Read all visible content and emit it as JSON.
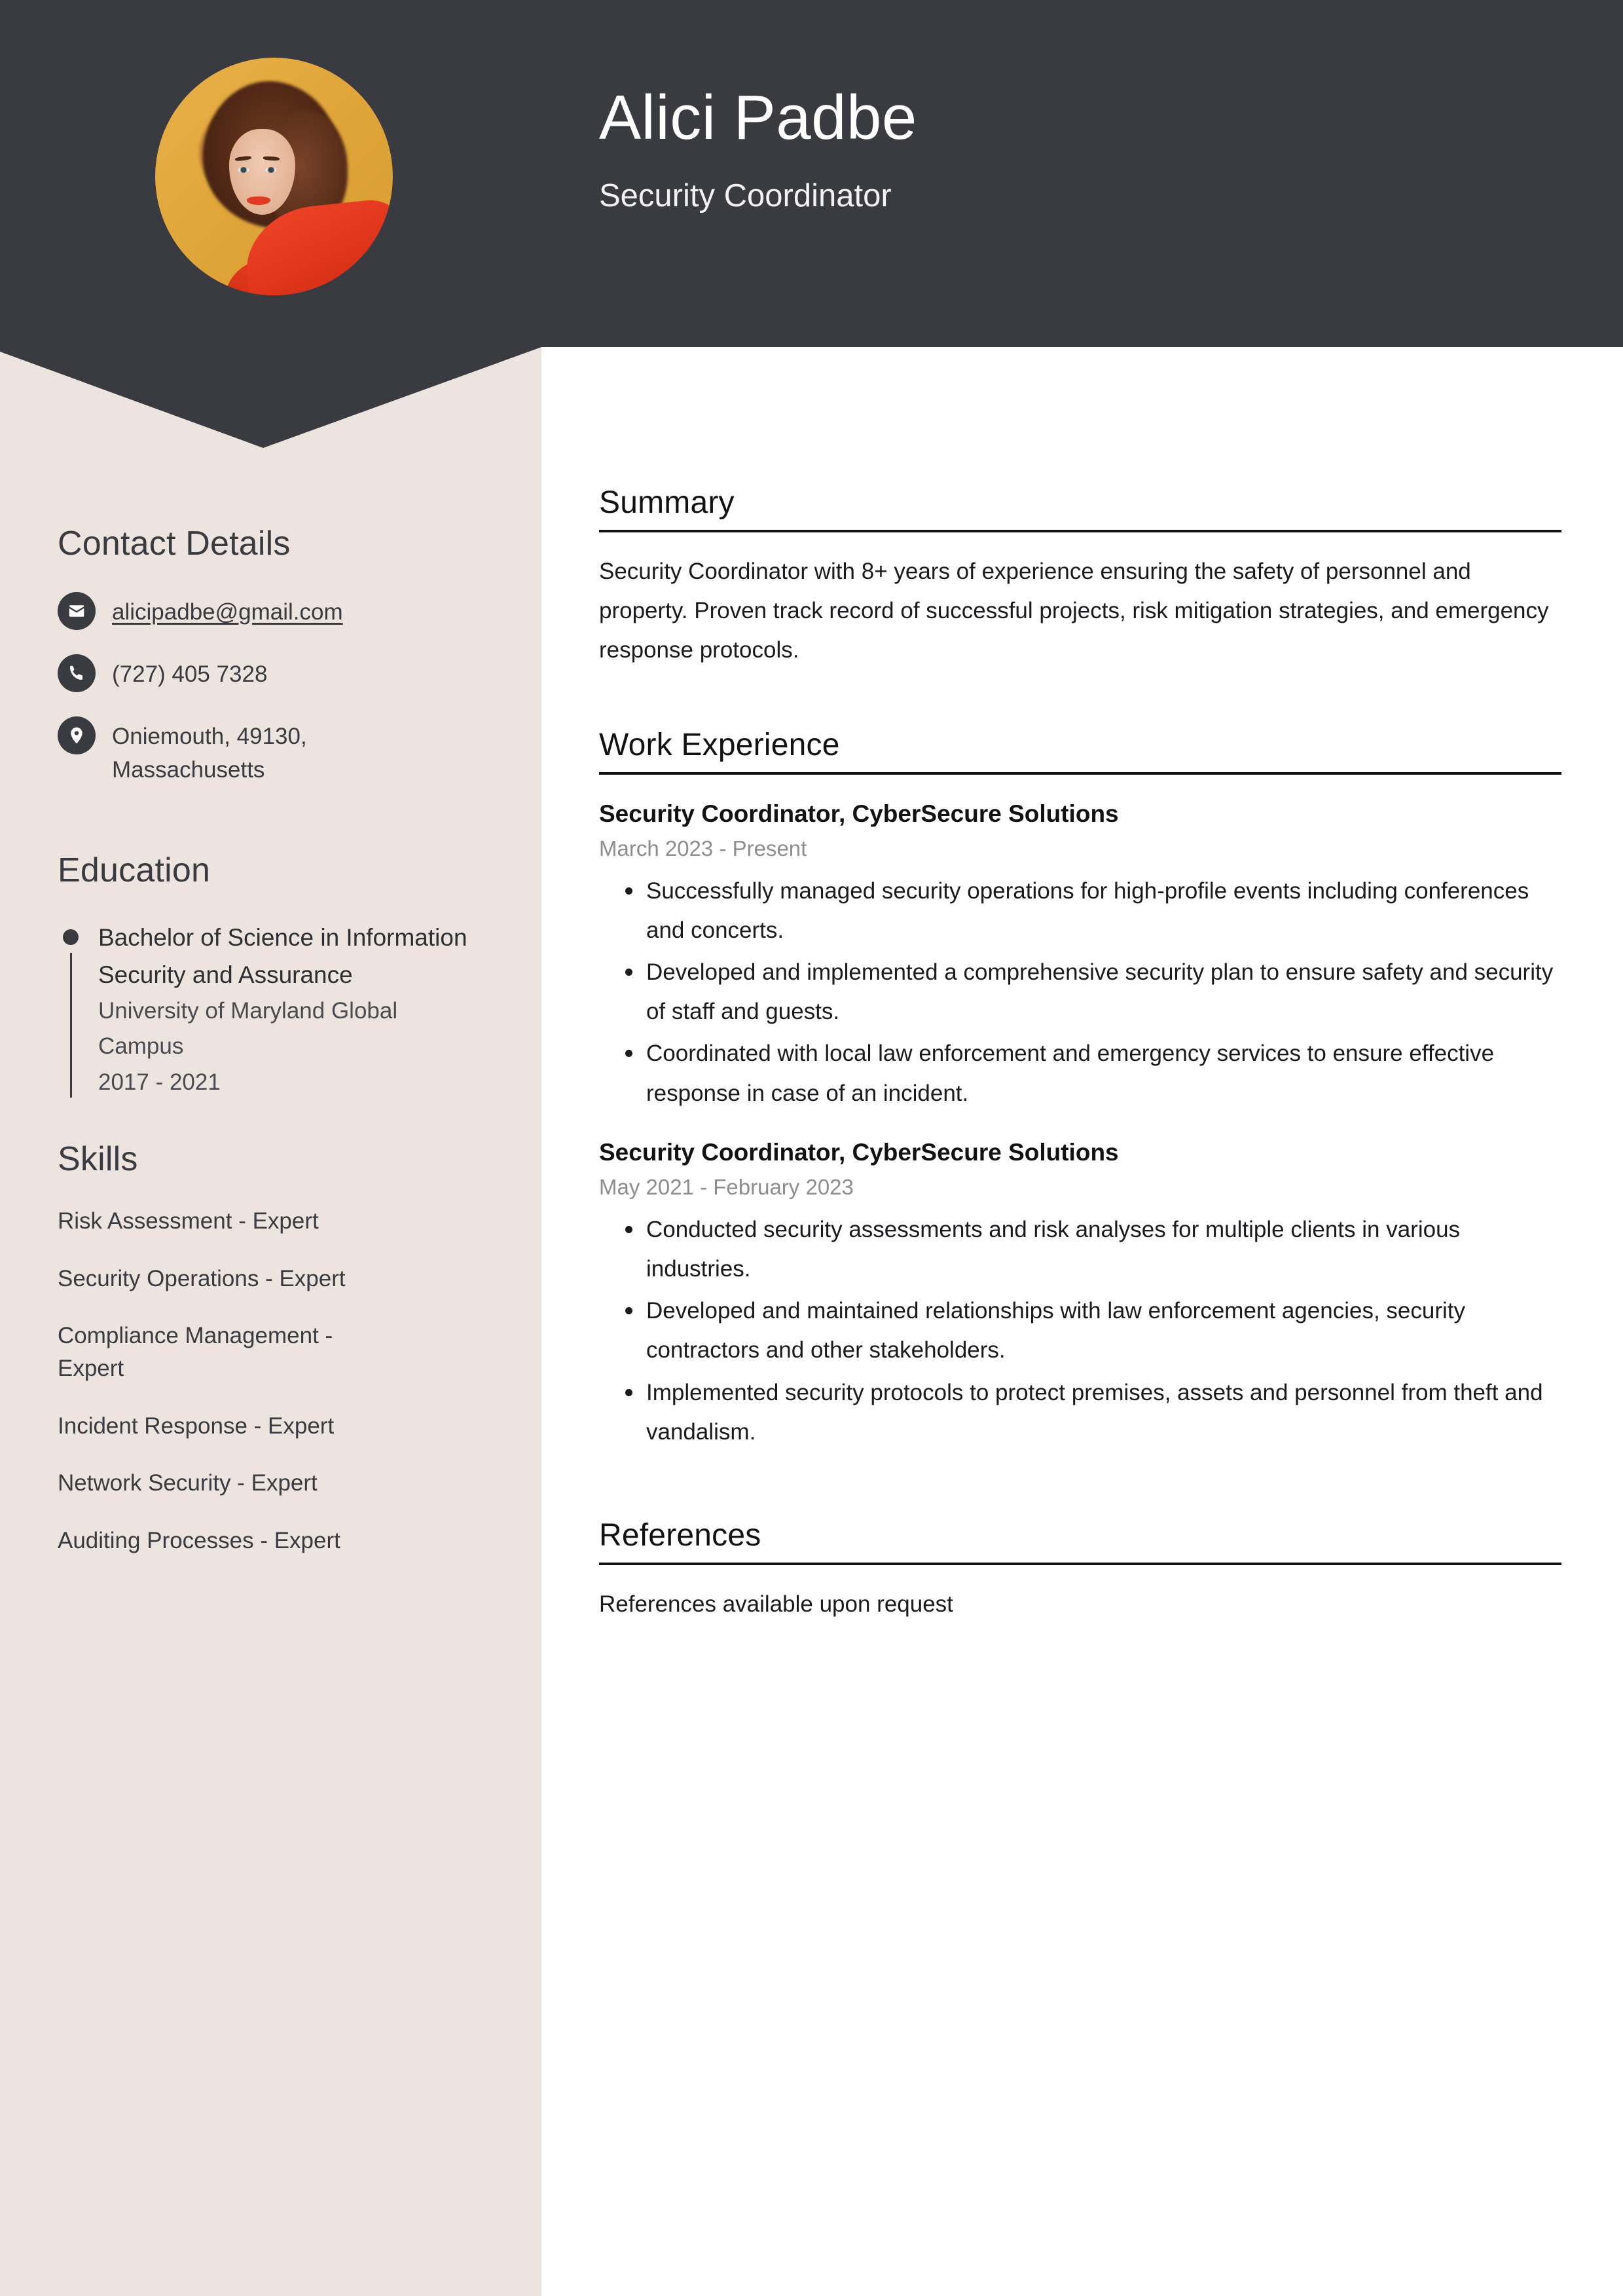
{
  "theme": {
    "header_bg": "#3A3B40",
    "sidebar_bg": "#EDE4DF",
    "page_bg": "#FFFFFF",
    "accent_text": "#3A3B40",
    "muted_text": "#8D8D8D",
    "avatar_bg": "#E0A63A"
  },
  "header": {
    "name": "Alici Padbe",
    "job_title": "Security Coordinator",
    "avatar_alt": "profile-photo"
  },
  "sidebar": {
    "contact": {
      "heading": "Contact Details",
      "items": [
        {
          "icon": "envelope-icon",
          "value": "alicipadbe@gmail.com",
          "is_link": true
        },
        {
          "icon": "phone-icon",
          "value": "(727) 405 7328",
          "is_link": false
        },
        {
          "icon": "location-pin-icon",
          "value": "Oniemouth, 49130, Massachusetts",
          "is_link": false
        }
      ]
    },
    "education": {
      "heading": "Education",
      "items": [
        {
          "degree": "Bachelor of Science in Information Security and Assurance",
          "school": "University of Maryland Global Campus",
          "years": "2017 - 2021"
        }
      ]
    },
    "skills": {
      "heading": "Skills",
      "items": [
        "Risk Assessment - Expert",
        "Security Operations - Expert",
        "Compliance Management - Expert",
        "Incident Response - Expert",
        "Network Security - Expert",
        "Auditing Processes - Expert"
      ]
    }
  },
  "main": {
    "summary": {
      "heading": "Summary",
      "text": "Security Coordinator with 8+ years of experience ensuring the safety of personnel and property. Proven track record of successful projects, risk mitigation strategies, and emergency response protocols."
    },
    "work_experience": {
      "heading": "Work Experience",
      "jobs": [
        {
          "role": "Security Coordinator, CyberSecure Solutions",
          "dates": "March 2023 - Present",
          "bullets": [
            "Successfully managed security operations for high-profile events including conferences and concerts.",
            "Developed and implemented a comprehensive security plan to ensure safety and security of staff and guests.",
            "Coordinated with local law enforcement and emergency services to ensure effective response in case of an incident."
          ]
        },
        {
          "role": "Security Coordinator, CyberSecure Solutions",
          "dates": "May 2021 - February 2023",
          "bullets": [
            "Conducted security assessments and risk analyses for multiple clients in various industries.",
            "Developed and maintained relationships with law enforcement agencies, security contractors and other stakeholders.",
            "Implemented security protocols to protect premises, assets and personnel from theft and vandalism."
          ]
        }
      ]
    },
    "references": {
      "heading": "References",
      "text": "References available upon request"
    }
  }
}
